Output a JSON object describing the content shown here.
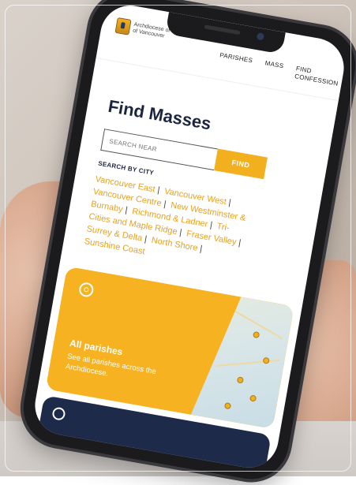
{
  "header": {
    "logo_line1": "Archdiocese of",
    "logo_line2": "of Vancouver",
    "nav": [
      {
        "label": "PARISHES"
      },
      {
        "label": "MASS"
      },
      {
        "label": "FIND CONFESSION"
      }
    ]
  },
  "main": {
    "title": "Find Masses",
    "search": {
      "placeholder": "SEARCH NEAR",
      "button_label": "FIND"
    },
    "search_by_city_label": "SEARCH BY CITY",
    "cities": [
      "Vancouver East",
      "Vancouver West",
      "Vancouver Centre",
      "New Westminster & Burnaby",
      "Richmond & Ladner",
      "Tri-Cities and Maple Ridge",
      "Fraser Valley",
      "Surrey & Delta",
      "North Shore",
      "Sunshine Coast"
    ],
    "card": {
      "title": "All parishes",
      "text": "See all parishes across the Archdiocese."
    }
  },
  "colors": {
    "accent": "#f2b01e",
    "link": "#e8a21a",
    "heading": "#1c2540",
    "card": "#f6b221"
  }
}
